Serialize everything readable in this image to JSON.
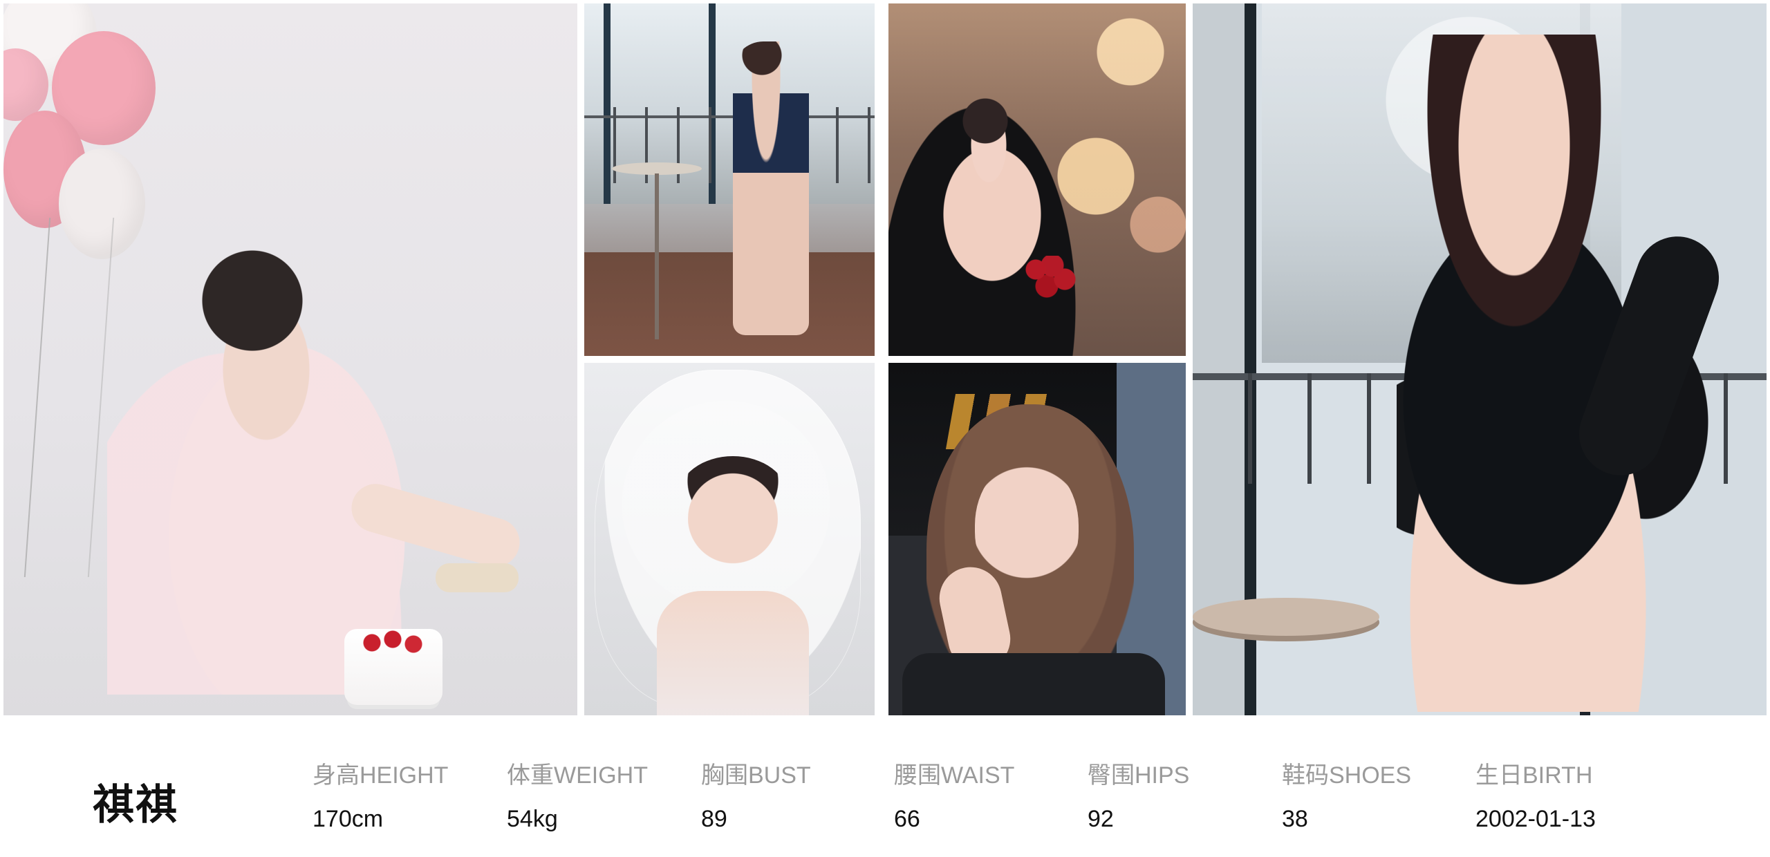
{
  "profile": {
    "name": "祺祺",
    "metrics": [
      {
        "label": "身高HEIGHT",
        "value": "170cm"
      },
      {
        "label": "体重WEIGHT",
        "value": "54kg"
      },
      {
        "label": "胸围BUST",
        "value": "89"
      },
      {
        "label": "腰围WAIST",
        "value": "66"
      },
      {
        "label": "臀围HIPS",
        "value": "92"
      },
      {
        "label": "鞋码SHOES",
        "value": "38"
      },
      {
        "label": "生日BIRTH",
        "value": "2002-01-13"
      }
    ]
  }
}
